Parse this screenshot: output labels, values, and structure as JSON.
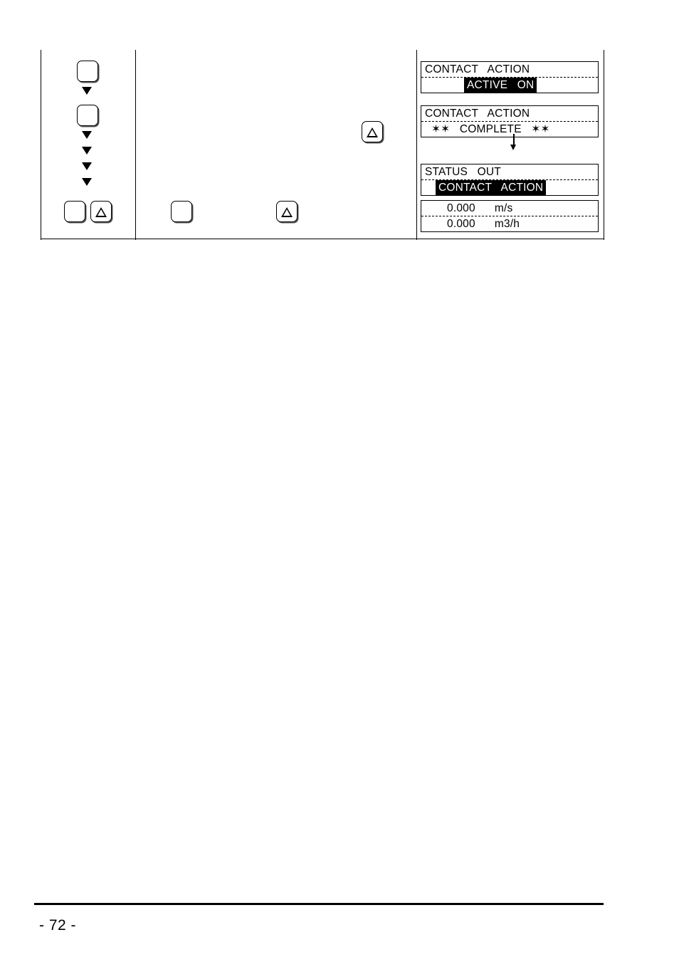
{
  "page": {
    "number_label": "- 72 -"
  },
  "procedure": {
    "key_column": {
      "keys": [
        {
          "name": "key-blank-1",
          "glyph": ""
        },
        {
          "name": "key-blank-2",
          "glyph": ""
        },
        {
          "name": "key-blank-3",
          "glyph": ""
        },
        {
          "name": "key-triangle-up-1",
          "glyph": "triangle-up"
        }
      ],
      "arrow_glyph": "arrow-down"
    },
    "action_column": {
      "keys": [
        {
          "name": "key-triangle-up-2",
          "glyph": "triangle-up"
        },
        {
          "name": "key-blank-4",
          "glyph": ""
        },
        {
          "name": "key-triangle-up-3",
          "glyph": "triangle-up"
        }
      ]
    },
    "display_column": {
      "transition_arrow": "↓",
      "screens": [
        {
          "name": "lcd-contact-action-active",
          "line1": {
            "text": "CONTACT   ACTION",
            "inverse": false,
            "indent": 5
          },
          "line2": {
            "text": "ACTIVE   ON",
            "inverse": true,
            "indent": 60
          }
        },
        {
          "name": "lcd-contact-action-complete",
          "line1": {
            "text": "CONTACT   ACTION",
            "inverse": false,
            "indent": 5
          },
          "line2": {
            "text": "✶✶   COMPLETE   ✶✶",
            "inverse": false,
            "indent": 14
          }
        },
        {
          "name": "lcd-status-out",
          "line1": {
            "text": "STATUS   OUT",
            "inverse": false,
            "indent": 5
          },
          "line2": {
            "text": "CONTACT   ACTION",
            "inverse": true,
            "indent": 20
          }
        },
        {
          "name": "lcd-measurement",
          "line1": {
            "text": "0.000      m/s",
            "inverse": false,
            "indent": 36
          },
          "line2": {
            "text": "0.000      m3/h",
            "inverse": false,
            "indent": 36
          }
        }
      ]
    }
  }
}
